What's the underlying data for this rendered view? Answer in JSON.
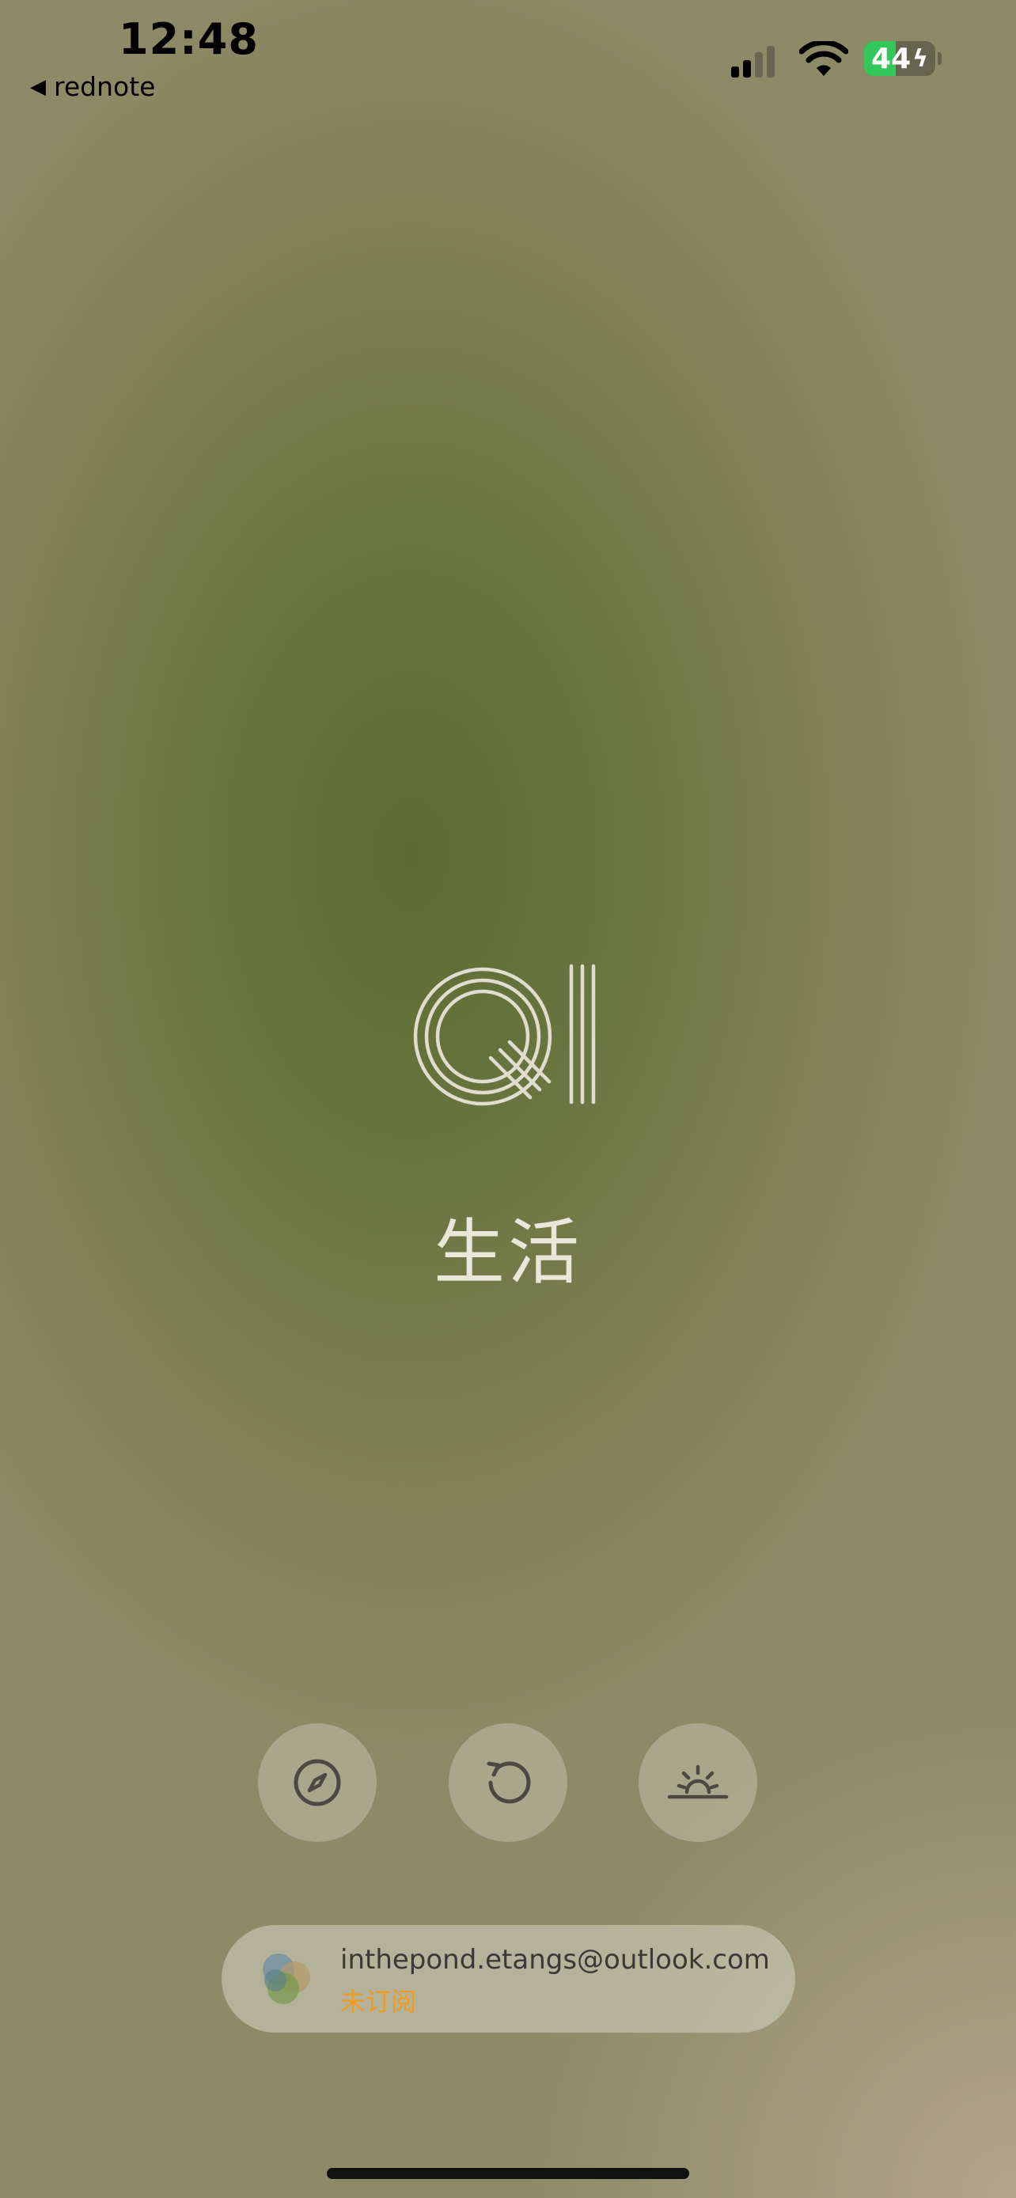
{
  "status_bar": {
    "time": "12:48",
    "back_app_label": "rednote",
    "back_icon": "back-triangle-icon",
    "battery_percent": "44"
  },
  "logo": {
    "icon": "qi-logo-icon",
    "label": "生活"
  },
  "actions": [
    {
      "icon": "compass-icon"
    },
    {
      "icon": "refresh-icon"
    },
    {
      "icon": "sunrise-icon"
    }
  ],
  "account": {
    "email": "inthepond.etangs@outlook.com",
    "status": "未订阅",
    "status_color": "#f19b1f"
  },
  "colors": {
    "background_center": "#5c6b30",
    "background_edge": "#8f8c6c",
    "logo_stroke": "#e0ddd0",
    "button_icon": "#4a4a42"
  }
}
